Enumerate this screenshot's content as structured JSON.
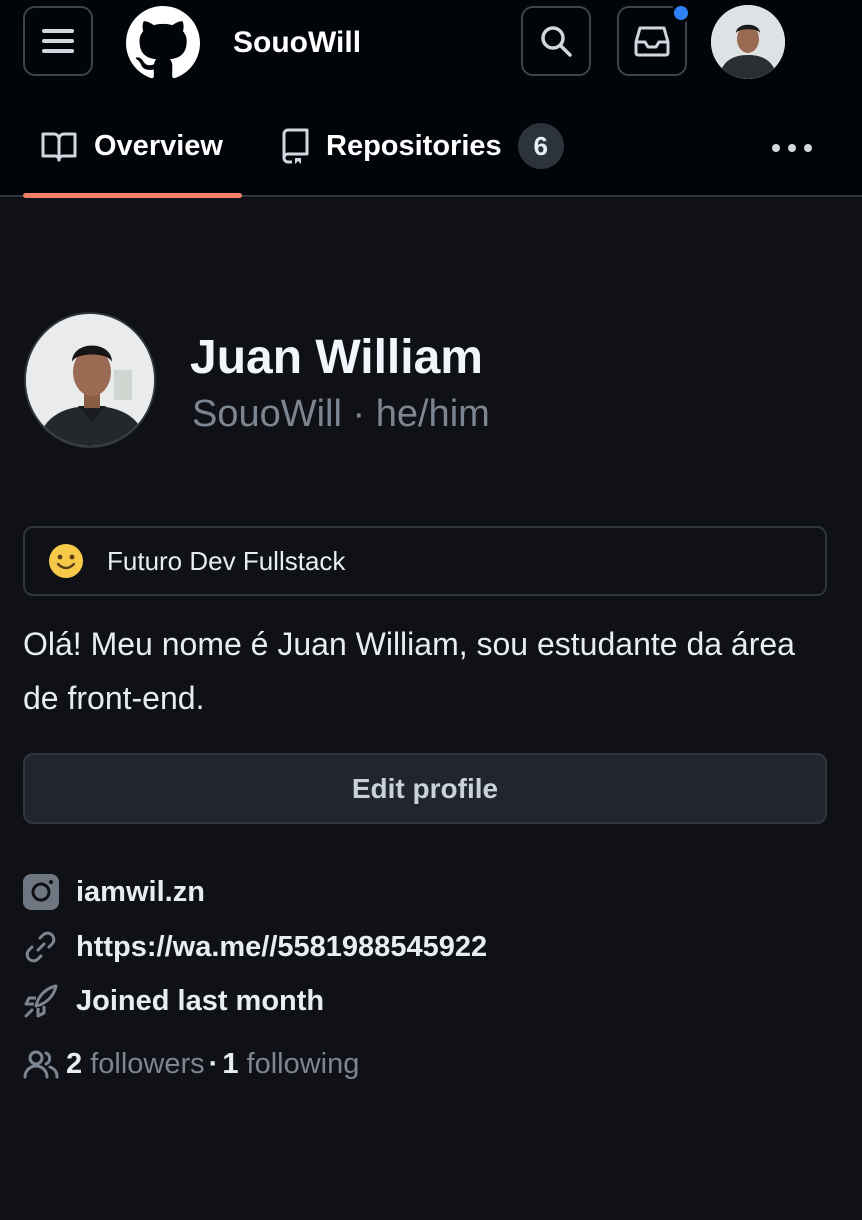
{
  "topbar": {
    "username": "SouoWill",
    "menu_icon": "hamburger-menu-icon",
    "logo_icon": "github-octocat-icon",
    "search_icon": "search-icon",
    "inbox_icon": "inbox-icon",
    "has_notification": true,
    "accent_dot_color": "#2f81f7"
  },
  "tabs": [
    {
      "label": "Overview",
      "icon": "book-icon",
      "selected": true
    },
    {
      "label": "Repositories",
      "icon": "repo-icon",
      "count": "6"
    }
  ],
  "tab_underline_color": "#f78166",
  "profile": {
    "name": "Juan William",
    "login": "SouoWill",
    "separator": " · ",
    "pronouns": "he/him",
    "status": {
      "emoji": "slightly-smiling-face-icon",
      "text": "Futuro Dev Fullstack"
    },
    "bio": "Olá! Meu nome é Juan William, sou estudante da área de front-end.",
    "edit_button": "Edit profile"
  },
  "details": {
    "instagram": "iamwil.zn",
    "link": "https://wa.me//5581988545922",
    "joined": "Joined last month",
    "followers_count": "2",
    "followers_label": "followers",
    "dot": "·",
    "following_count": "1",
    "following_label": "following"
  }
}
